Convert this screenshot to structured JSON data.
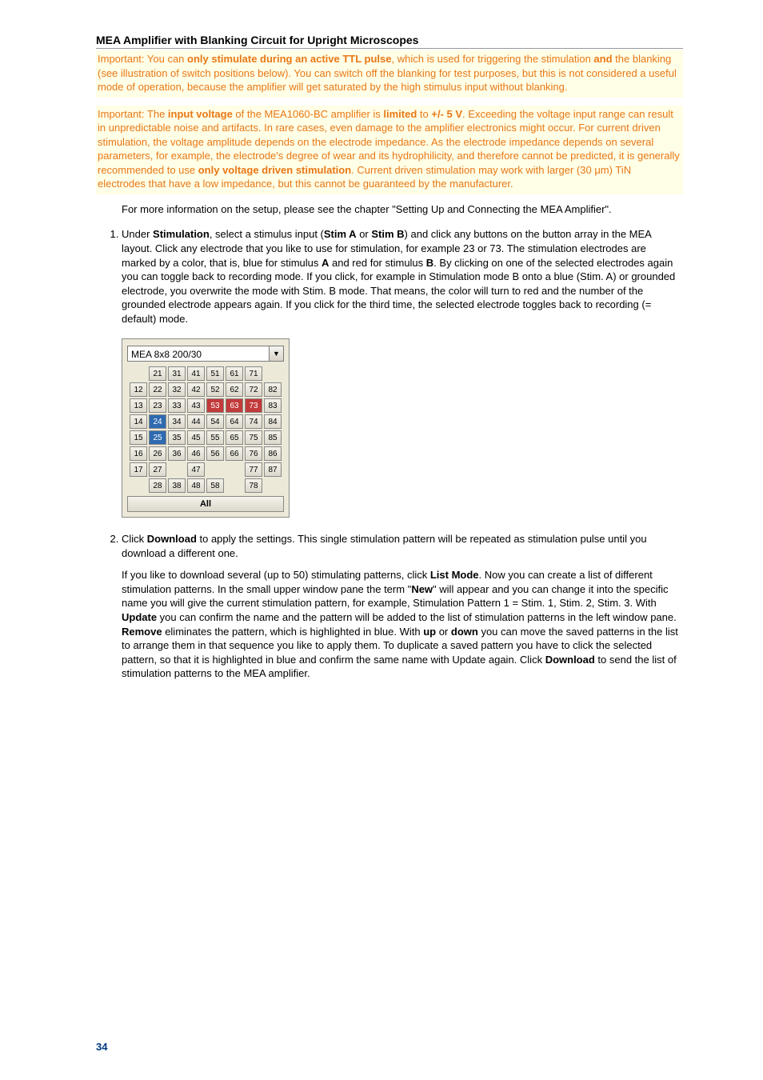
{
  "doc": {
    "title": "MEA Amplifier with Blanking Circuit for Upright Microscopes",
    "page_number": "34"
  },
  "callout1": {
    "lead": "Important: You can ",
    "b1": "only stimulate during an active TTL pulse",
    "t2": ", which is used for triggering the stimulation ",
    "b2": "and",
    "t3": " the blanking (see illustration of switch positions below). You can switch off the blanking for test purposes, but this is not considered a useful mode of operation, because the amplifier will get saturated by the high stimulus input without blanking."
  },
  "callout2": {
    "lead": "Important: The ",
    "b1": "input voltage",
    "t2": " of the MEA1060-BC amplifier is ",
    "b2": "limited",
    "t3": " to ",
    "b3": "+/- 5 V",
    "t4": ". Exceeding the voltage input range can result in unpredictable noise and artifacts. In rare cases, even damage to the amplifier electronics might occur. For current driven stimulation, the voltage amplitude depends on the electrode impedance. As the electrode impedance depends on several parameters, for example, the electrode's degree of wear and its hydrophilicity, and therefore cannot be predicted, it is generally recommended to use ",
    "b4": "only voltage driven stimulation",
    "t5": ". Current driven stimulation may work with larger (30 μm) TiN electrodes that have a low impedance, but this cannot be guaranteed by the manufacturer."
  },
  "plain": {
    "text": "For more information on the setup, please see the chapter \"Setting Up and Connecting the MEA Amplifier\"."
  },
  "step1": {
    "pre": "Under ",
    "b1": "Stimulation",
    "t2": ", select a stimulus input (",
    "b2": "Stim A",
    "t3": " or ",
    "b3": "Stim B",
    "t4": ") and click any buttons on the button array in the MEA layout. Click any electrode that you like to use for stimulation, for example 23 or 73. The stimulation electrodes are marked by a color, that is, blue for stimulus ",
    "b4": "A",
    "t5": " and red for stimulus ",
    "b5": "B",
    "t6": ". By clicking on one of the selected electrodes again you can toggle back to recording mode. If you click, for example in Stimulation mode B onto a blue (Stim. A) or grounded electrode, you overwrite the mode with Stim. B mode. That means, the color will turn to red and the number of the grounded electrode appears again. If you click for the third time, the selected electrode toggles back to recording (= default) mode."
  },
  "mea": {
    "combo_value": "MEA 8x8 200/30",
    "all_label": "All",
    "cells": [
      [
        "",
        "21",
        "31",
        "41",
        "51",
        "61",
        "71",
        ""
      ],
      [
        "12",
        "22",
        "32",
        "42",
        "52",
        "62",
        "72",
        "82"
      ],
      [
        "13",
        "23",
        "33",
        "43",
        "53",
        "63",
        "73",
        "83"
      ],
      [
        "14",
        "24",
        "34",
        "44",
        "54",
        "64",
        "74",
        "84"
      ],
      [
        "15",
        "25",
        "35",
        "45",
        "55",
        "65",
        "75",
        "85"
      ],
      [
        "16",
        "26",
        "36",
        "46",
        "56",
        "66",
        "76",
        "86"
      ],
      [
        "17",
        "27",
        "",
        "47",
        "",
        "",
        "77",
        "87"
      ],
      [
        "",
        "28",
        "38",
        "48",
        "58",
        "",
        "78",
        ""
      ]
    ],
    "blue": [
      "24",
      "25"
    ],
    "red": [
      "53",
      "63",
      "73"
    ]
  },
  "step2": {
    "pre": "Click ",
    "b1": "Download",
    "t2": " to apply the settings. This single stimulation pattern will be repeated as stimulation pulse until you download a different one."
  },
  "step2b": {
    "t1": "If you like to download several (up to 50) stimulating patterns, click ",
    "b1": "List Mode",
    "t2": ". Now you can create a list of different stimulation patterns. In the small upper window pane the term \"",
    "b2": "New",
    "t3": "\" will appear and you can change it into the specific name you will give the current stimulation pattern, for example, Stimulation Pattern 1 = Stim. 1, Stim. 2, Stim. 3. With ",
    "b3": "Update",
    "t4": " you can confirm the name and the pattern will be added to the list of stimulation patterns in the left window pane. ",
    "b4": "Remove",
    "t5": " eliminates the pattern, which is highlighted in blue. With ",
    "b5": "up",
    "t6": " or ",
    "b6": "down",
    "t7": " you can move the saved patterns in the list to arrange them in that sequence you like to apply them. To duplicate a saved pattern you have to click the selected pattern, so that it is highlighted in blue and confirm the same name with Update again. Click ",
    "b7": "Download",
    "t8": " to send the list of stimulation patterns to the MEA amplifier."
  }
}
